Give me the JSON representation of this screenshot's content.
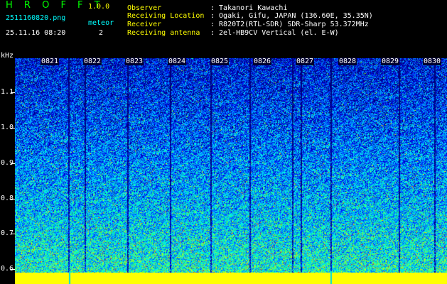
{
  "header": {
    "app_title": "H R O F F T",
    "version": "1.0.0",
    "filename": "2511160820.png",
    "datetime": "25.11.16 08:20",
    "meteor_label": "meteor",
    "meteor_count": "2"
  },
  "info": [
    {
      "label": "Observer",
      "value": ": Takanori Kawachi"
    },
    {
      "label": "Receiving Location",
      "value": ": Ogaki, Gifu, JAPAN (136.60E, 35.35N)"
    },
    {
      "label": "Receiver",
      "value": ": R820T2(RTL-SDR) SDR-Sharp 53.372MHz"
    },
    {
      "label": "Receiving antenna",
      "value": ": 2el-HB9CV Vertical (el. E-W)"
    }
  ],
  "axis": {
    "unit": "kHz",
    "freq_ticks": [
      "1.1",
      "1.0",
      "0.9",
      "0.8",
      "0.7",
      "0.6"
    ],
    "time_ticks": [
      "0821",
      "0822",
      "0823",
      "0824",
      "0825",
      "0826",
      "0827",
      "0828",
      "0829",
      "0830"
    ]
  },
  "colors": {
    "background": "#000000",
    "text_white": "#ffffff",
    "text_yellow": "#ffff00",
    "text_green": "#00ff00",
    "text_cyan": "#00ffff",
    "spectrum_low": "#0000aa",
    "spectrum_high": "#ff0000",
    "baseline": "#ffff00"
  }
}
